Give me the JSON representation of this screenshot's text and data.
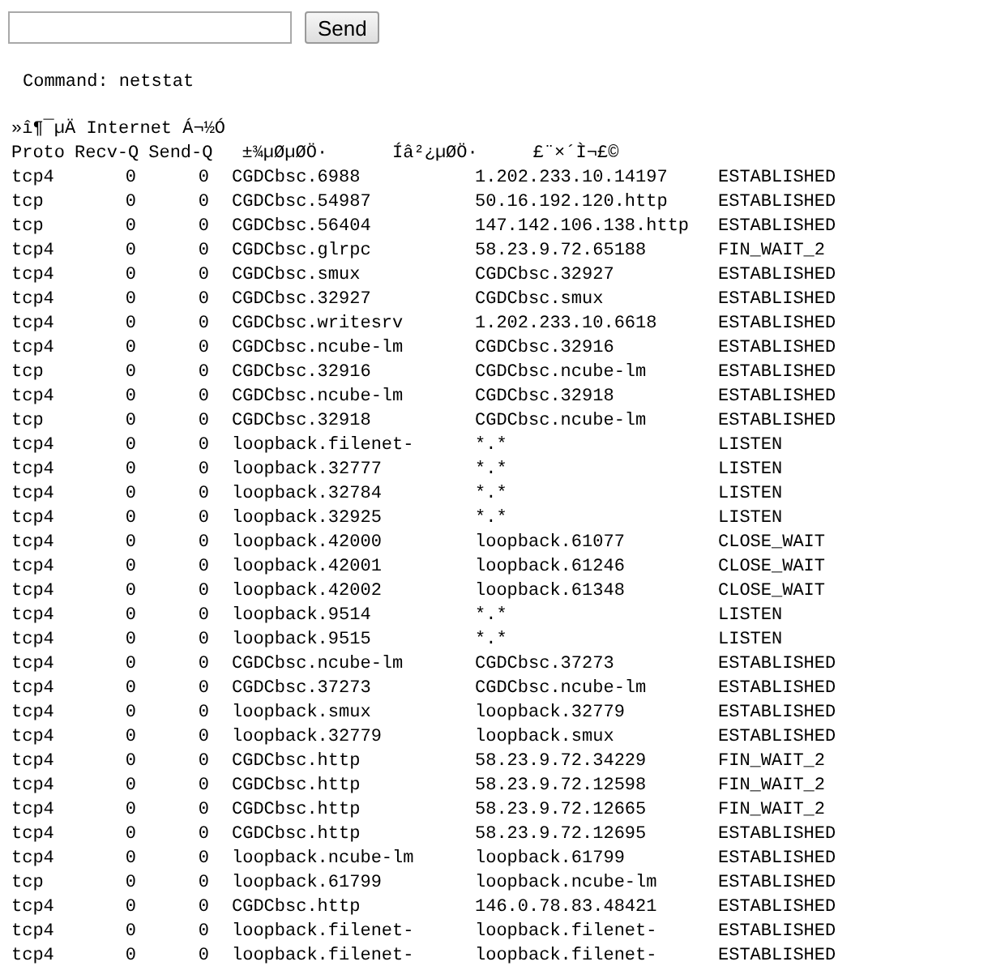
{
  "form": {
    "button": "Send"
  },
  "command": "Command: netstat",
  "section_title": "»î¶¯µÄ Internet Á¬½Ó",
  "columns": [
    "Proto",
    "Recv-Q",
    "Send-Q",
    "±¾µØµØÖ·",
    "Íâ²¿µØÖ·",
    "£¨×´Ì¬£©"
  ],
  "rows": [
    [
      "tcp4",
      "0",
      "0",
      "CGDCbsc.6988",
      "1.202.233.10.14197",
      "ESTABLISHED"
    ],
    [
      "tcp",
      "0",
      "0",
      "CGDCbsc.54987",
      "50.16.192.120.http",
      "ESTABLISHED"
    ],
    [
      "tcp",
      "0",
      "0",
      "CGDCbsc.56404",
      "147.142.106.138.http",
      "ESTABLISHED"
    ],
    [
      "tcp4",
      "0",
      "0",
      "CGDCbsc.glrpc",
      "58.23.9.72.65188",
      "FIN_WAIT_2"
    ],
    [
      "tcp4",
      "0",
      "0",
      "CGDCbsc.smux",
      "CGDCbsc.32927",
      "ESTABLISHED"
    ],
    [
      "tcp4",
      "0",
      "0",
      "CGDCbsc.32927",
      "CGDCbsc.smux",
      "ESTABLISHED"
    ],
    [
      "tcp4",
      "0",
      "0",
      "CGDCbsc.writesrv",
      "1.202.233.10.6618",
      "ESTABLISHED"
    ],
    [
      "tcp4",
      "0",
      "0",
      "CGDCbsc.ncube-lm",
      "CGDCbsc.32916",
      "ESTABLISHED"
    ],
    [
      "tcp",
      "0",
      "0",
      "CGDCbsc.32916",
      "CGDCbsc.ncube-lm",
      "ESTABLISHED"
    ],
    [
      "tcp4",
      "0",
      "0",
      "CGDCbsc.ncube-lm",
      "CGDCbsc.32918",
      "ESTABLISHED"
    ],
    [
      "tcp",
      "0",
      "0",
      "CGDCbsc.32918",
      "CGDCbsc.ncube-lm",
      "ESTABLISHED"
    ],
    [
      "tcp4",
      "0",
      "0",
      "loopback.filenet-",
      "*.*",
      "LISTEN"
    ],
    [
      "tcp4",
      "0",
      "0",
      "loopback.32777",
      "*.*",
      "LISTEN"
    ],
    [
      "tcp4",
      "0",
      "0",
      "loopback.32784",
      "*.*",
      "LISTEN"
    ],
    [
      "tcp4",
      "0",
      "0",
      "loopback.32925",
      "*.*",
      "LISTEN"
    ],
    [
      "tcp4",
      "0",
      "0",
      "loopback.42000",
      "loopback.61077",
      "CLOSE_WAIT"
    ],
    [
      "tcp4",
      "0",
      "0",
      "loopback.42001",
      "loopback.61246",
      "CLOSE_WAIT"
    ],
    [
      "tcp4",
      "0",
      "0",
      "loopback.42002",
      "loopback.61348",
      "CLOSE_WAIT"
    ],
    [
      "tcp4",
      "0",
      "0",
      "loopback.9514",
      "*.*",
      "LISTEN"
    ],
    [
      "tcp4",
      "0",
      "0",
      "loopback.9515",
      "*.*",
      "LISTEN"
    ],
    [
      "tcp4",
      "0",
      "0",
      "CGDCbsc.ncube-lm",
      "CGDCbsc.37273",
      "ESTABLISHED"
    ],
    [
      "tcp4",
      "0",
      "0",
      "CGDCbsc.37273",
      "CGDCbsc.ncube-lm",
      "ESTABLISHED"
    ],
    [
      "tcp4",
      "0",
      "0",
      "loopback.smux",
      "loopback.32779",
      "ESTABLISHED"
    ],
    [
      "tcp4",
      "0",
      "0",
      "loopback.32779",
      "loopback.smux",
      "ESTABLISHED"
    ],
    [
      "tcp4",
      "0",
      "0",
      "CGDCbsc.http",
      "58.23.9.72.34229",
      "FIN_WAIT_2"
    ],
    [
      "tcp4",
      "0",
      "0",
      "CGDCbsc.http",
      "58.23.9.72.12598",
      "FIN_WAIT_2"
    ],
    [
      "tcp4",
      "0",
      "0",
      "CGDCbsc.http",
      "58.23.9.72.12665",
      "FIN_WAIT_2"
    ],
    [
      "tcp4",
      "0",
      "0",
      "CGDCbsc.http",
      "58.23.9.72.12695",
      "ESTABLISHED"
    ],
    [
      "tcp4",
      "0",
      "0",
      "loopback.ncube-lm",
      "loopback.61799",
      "ESTABLISHED"
    ],
    [
      "tcp",
      "0",
      "0",
      "loopback.61799",
      "loopback.ncube-lm",
      "ESTABLISHED"
    ],
    [
      "tcp4",
      "0",
      "0",
      "CGDCbsc.http",
      "146.0.78.83.48421",
      "ESTABLISHED"
    ],
    [
      "tcp4",
      "0",
      "0",
      "loopback.filenet-",
      "loopback.filenet-",
      "ESTABLISHED"
    ],
    [
      "tcp4",
      "0",
      "0",
      "loopback.filenet-",
      "loopback.filenet-",
      "ESTABLISHED"
    ]
  ]
}
